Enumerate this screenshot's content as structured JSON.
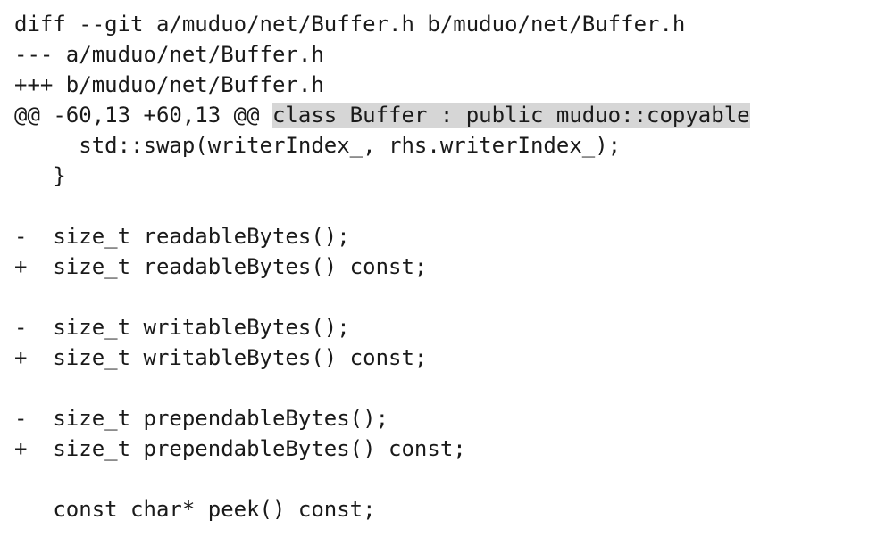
{
  "diff": {
    "header_git": "diff --git a/muduo/net/Buffer.h b/muduo/net/Buffer.h",
    "header_old": "--- a/muduo/net/Buffer.h",
    "header_new": "+++ b/muduo/net/Buffer.h",
    "hunk_range": "@@ -60,13 +60,13 @@ ",
    "hunk_context": "class Buffer : public muduo::copyable",
    "lines": [
      "     std::swap(writerIndex_, rhs.writerIndex_);",
      "   }",
      "-  size_t readableBytes();",
      "+  size_t readableBytes() const;",
      "-  size_t writableBytes();",
      "+  size_t writableBytes() const;",
      "-  size_t prependableBytes();",
      "+  size_t prependableBytes() const;",
      "   const char* peek() const;"
    ]
  }
}
